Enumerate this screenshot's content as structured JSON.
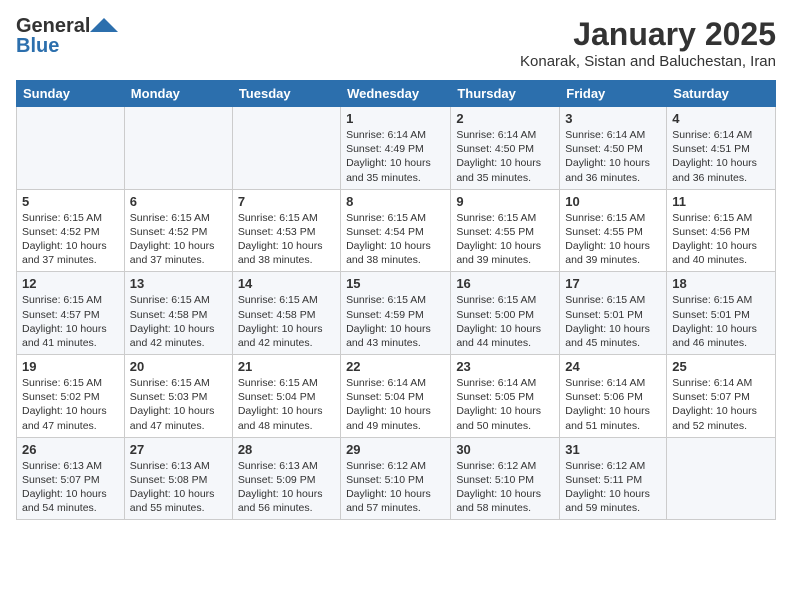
{
  "header": {
    "logo_general": "General",
    "logo_blue": "Blue",
    "month_title": "January 2025",
    "location": "Konarak, Sistan and Baluchestan, Iran"
  },
  "days_of_week": [
    "Sunday",
    "Monday",
    "Tuesday",
    "Wednesday",
    "Thursday",
    "Friday",
    "Saturday"
  ],
  "weeks": [
    [
      {
        "day": "",
        "content": ""
      },
      {
        "day": "",
        "content": ""
      },
      {
        "day": "",
        "content": ""
      },
      {
        "day": "1",
        "content": "Sunrise: 6:14 AM\nSunset: 4:49 PM\nDaylight: 10 hours\nand 35 minutes."
      },
      {
        "day": "2",
        "content": "Sunrise: 6:14 AM\nSunset: 4:50 PM\nDaylight: 10 hours\nand 35 minutes."
      },
      {
        "day": "3",
        "content": "Sunrise: 6:14 AM\nSunset: 4:50 PM\nDaylight: 10 hours\nand 36 minutes."
      },
      {
        "day": "4",
        "content": "Sunrise: 6:14 AM\nSunset: 4:51 PM\nDaylight: 10 hours\nand 36 minutes."
      }
    ],
    [
      {
        "day": "5",
        "content": "Sunrise: 6:15 AM\nSunset: 4:52 PM\nDaylight: 10 hours\nand 37 minutes."
      },
      {
        "day": "6",
        "content": "Sunrise: 6:15 AM\nSunset: 4:52 PM\nDaylight: 10 hours\nand 37 minutes."
      },
      {
        "day": "7",
        "content": "Sunrise: 6:15 AM\nSunset: 4:53 PM\nDaylight: 10 hours\nand 38 minutes."
      },
      {
        "day": "8",
        "content": "Sunrise: 6:15 AM\nSunset: 4:54 PM\nDaylight: 10 hours\nand 38 minutes."
      },
      {
        "day": "9",
        "content": "Sunrise: 6:15 AM\nSunset: 4:55 PM\nDaylight: 10 hours\nand 39 minutes."
      },
      {
        "day": "10",
        "content": "Sunrise: 6:15 AM\nSunset: 4:55 PM\nDaylight: 10 hours\nand 39 minutes."
      },
      {
        "day": "11",
        "content": "Sunrise: 6:15 AM\nSunset: 4:56 PM\nDaylight: 10 hours\nand 40 minutes."
      }
    ],
    [
      {
        "day": "12",
        "content": "Sunrise: 6:15 AM\nSunset: 4:57 PM\nDaylight: 10 hours\nand 41 minutes."
      },
      {
        "day": "13",
        "content": "Sunrise: 6:15 AM\nSunset: 4:58 PM\nDaylight: 10 hours\nand 42 minutes."
      },
      {
        "day": "14",
        "content": "Sunrise: 6:15 AM\nSunset: 4:58 PM\nDaylight: 10 hours\nand 42 minutes."
      },
      {
        "day": "15",
        "content": "Sunrise: 6:15 AM\nSunset: 4:59 PM\nDaylight: 10 hours\nand 43 minutes."
      },
      {
        "day": "16",
        "content": "Sunrise: 6:15 AM\nSunset: 5:00 PM\nDaylight: 10 hours\nand 44 minutes."
      },
      {
        "day": "17",
        "content": "Sunrise: 6:15 AM\nSunset: 5:01 PM\nDaylight: 10 hours\nand 45 minutes."
      },
      {
        "day": "18",
        "content": "Sunrise: 6:15 AM\nSunset: 5:01 PM\nDaylight: 10 hours\nand 46 minutes."
      }
    ],
    [
      {
        "day": "19",
        "content": "Sunrise: 6:15 AM\nSunset: 5:02 PM\nDaylight: 10 hours\nand 47 minutes."
      },
      {
        "day": "20",
        "content": "Sunrise: 6:15 AM\nSunset: 5:03 PM\nDaylight: 10 hours\nand 47 minutes."
      },
      {
        "day": "21",
        "content": "Sunrise: 6:15 AM\nSunset: 5:04 PM\nDaylight: 10 hours\nand 48 minutes."
      },
      {
        "day": "22",
        "content": "Sunrise: 6:14 AM\nSunset: 5:04 PM\nDaylight: 10 hours\nand 49 minutes."
      },
      {
        "day": "23",
        "content": "Sunrise: 6:14 AM\nSunset: 5:05 PM\nDaylight: 10 hours\nand 50 minutes."
      },
      {
        "day": "24",
        "content": "Sunrise: 6:14 AM\nSunset: 5:06 PM\nDaylight: 10 hours\nand 51 minutes."
      },
      {
        "day": "25",
        "content": "Sunrise: 6:14 AM\nSunset: 5:07 PM\nDaylight: 10 hours\nand 52 minutes."
      }
    ],
    [
      {
        "day": "26",
        "content": "Sunrise: 6:13 AM\nSunset: 5:07 PM\nDaylight: 10 hours\nand 54 minutes."
      },
      {
        "day": "27",
        "content": "Sunrise: 6:13 AM\nSunset: 5:08 PM\nDaylight: 10 hours\nand 55 minutes."
      },
      {
        "day": "28",
        "content": "Sunrise: 6:13 AM\nSunset: 5:09 PM\nDaylight: 10 hours\nand 56 minutes."
      },
      {
        "day": "29",
        "content": "Sunrise: 6:12 AM\nSunset: 5:10 PM\nDaylight: 10 hours\nand 57 minutes."
      },
      {
        "day": "30",
        "content": "Sunrise: 6:12 AM\nSunset: 5:10 PM\nDaylight: 10 hours\nand 58 minutes."
      },
      {
        "day": "31",
        "content": "Sunrise: 6:12 AM\nSunset: 5:11 PM\nDaylight: 10 hours\nand 59 minutes."
      },
      {
        "day": "",
        "content": ""
      }
    ]
  ]
}
